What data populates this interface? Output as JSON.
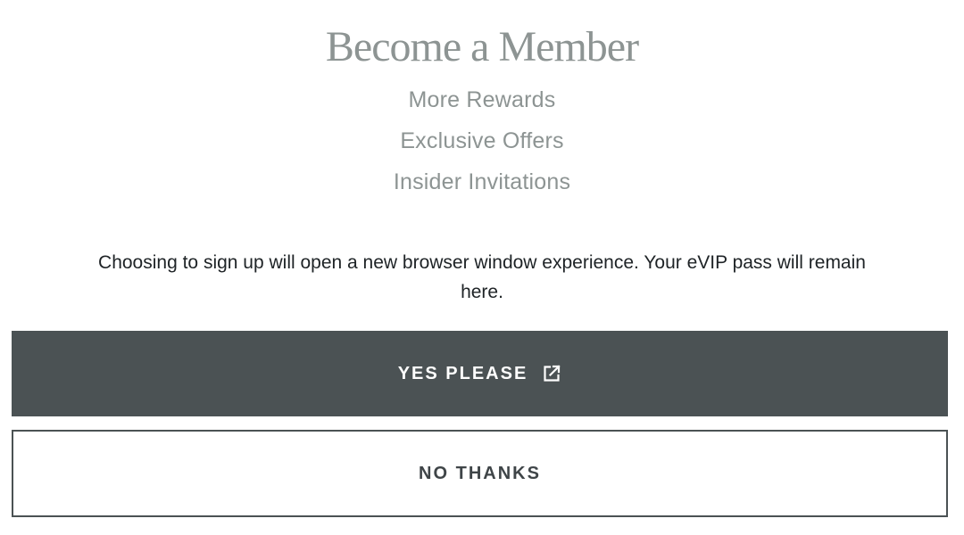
{
  "modal": {
    "title": "Become a Member",
    "benefits": [
      "More Rewards",
      "Exclusive Offers",
      "Insider Invitations"
    ],
    "notice": "Choosing to sign up will open a new browser window experience. Your eVIP pass will remain here.",
    "yes_label": "YES PLEASE",
    "yes_icon": "external-link-icon",
    "no_label": "NO THANKS"
  },
  "colors": {
    "primary_button": "#4b5254",
    "muted_text": "#8d9493",
    "body_text": "#1e2326",
    "background": "#ffffff"
  }
}
